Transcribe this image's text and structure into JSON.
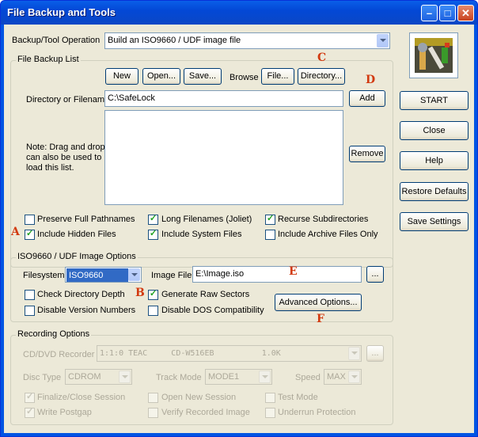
{
  "window": {
    "title": "File Backup and Tools"
  },
  "operation": {
    "label": "Backup/Tool Operation",
    "value": "Build an ISO9660 / UDF image file"
  },
  "backup_list": {
    "title": "File Backup List",
    "buttons": {
      "new": "New",
      "open": "Open...",
      "save": "Save...",
      "file": "File...",
      "directory": "Directory...",
      "add": "Add",
      "remove": "Remove"
    },
    "browse_label": "Browse",
    "dir_label": "Directory or Filename",
    "dir_value": "C:\\SafeLock",
    "note": [
      "Note: Drag and drop",
      "can also be used to",
      "load this list."
    ],
    "checkboxes": {
      "preserve": {
        "label": "Preserve Full Pathnames",
        "checked": false
      },
      "long": {
        "label": "Long Filenames (Joliet)",
        "checked": true
      },
      "recurse": {
        "label": "Recurse Subdirectories",
        "checked": true
      },
      "hidden": {
        "label": "Include Hidden Files",
        "checked": true
      },
      "system": {
        "label": "Include System Files",
        "checked": true
      },
      "archive": {
        "label": "Include Archive Files Only",
        "checked": false
      }
    }
  },
  "iso_options": {
    "title": "ISO9660 / UDF Image Options",
    "filesystem_label": "Filesystem",
    "filesystem_value": "ISO9660",
    "image_label": "Image File",
    "image_value": "E:\\Image.iso",
    "browse": "...",
    "advanced": "Advanced Options...",
    "checkboxes": {
      "check_depth": {
        "label": "Check Directory Depth",
        "checked": false
      },
      "raw": {
        "label": "Generate Raw Sectors",
        "checked": true
      },
      "disable_ver": {
        "label": "Disable Version Numbers",
        "checked": false
      },
      "disable_dos": {
        "label": "Disable DOS Compatibility",
        "checked": false
      }
    }
  },
  "recording": {
    "title": "Recording Options",
    "recorder_label": "CD/DVD Recorder",
    "recorder_value": "1:1:0 TEAC     CD-W516EB          1.0K",
    "browse": "...",
    "disc_label": "Disc Type",
    "disc_value": "CDROM",
    "track_label": "Track Mode",
    "track_value": "MODE1",
    "speed_label": "Speed",
    "speed_value": "MAX",
    "checkboxes": {
      "finalize": {
        "label": "Finalize/Close Session",
        "checked": true
      },
      "open_new": {
        "label": "Open New Session",
        "checked": false
      },
      "test": {
        "label": "Test Mode",
        "checked": false
      },
      "postgap": {
        "label": "Write Postgap",
        "checked": true
      },
      "verify": {
        "label": "Verify Recorded Image",
        "checked": false
      },
      "underrun": {
        "label": "Underrun Protection",
        "checked": false
      }
    }
  },
  "side": {
    "start": "START",
    "close": "Close",
    "help": "Help",
    "restore": "Restore Defaults",
    "save": "Save Settings"
  },
  "annotations": {
    "a": "A",
    "b": "B",
    "c": "C",
    "d": "D",
    "e": "E",
    "f": "F"
  },
  "colors": {
    "title_bar": "#0054e3",
    "face": "#ece9d8",
    "annotation": "#d23a10",
    "selection": "#316ac5"
  }
}
